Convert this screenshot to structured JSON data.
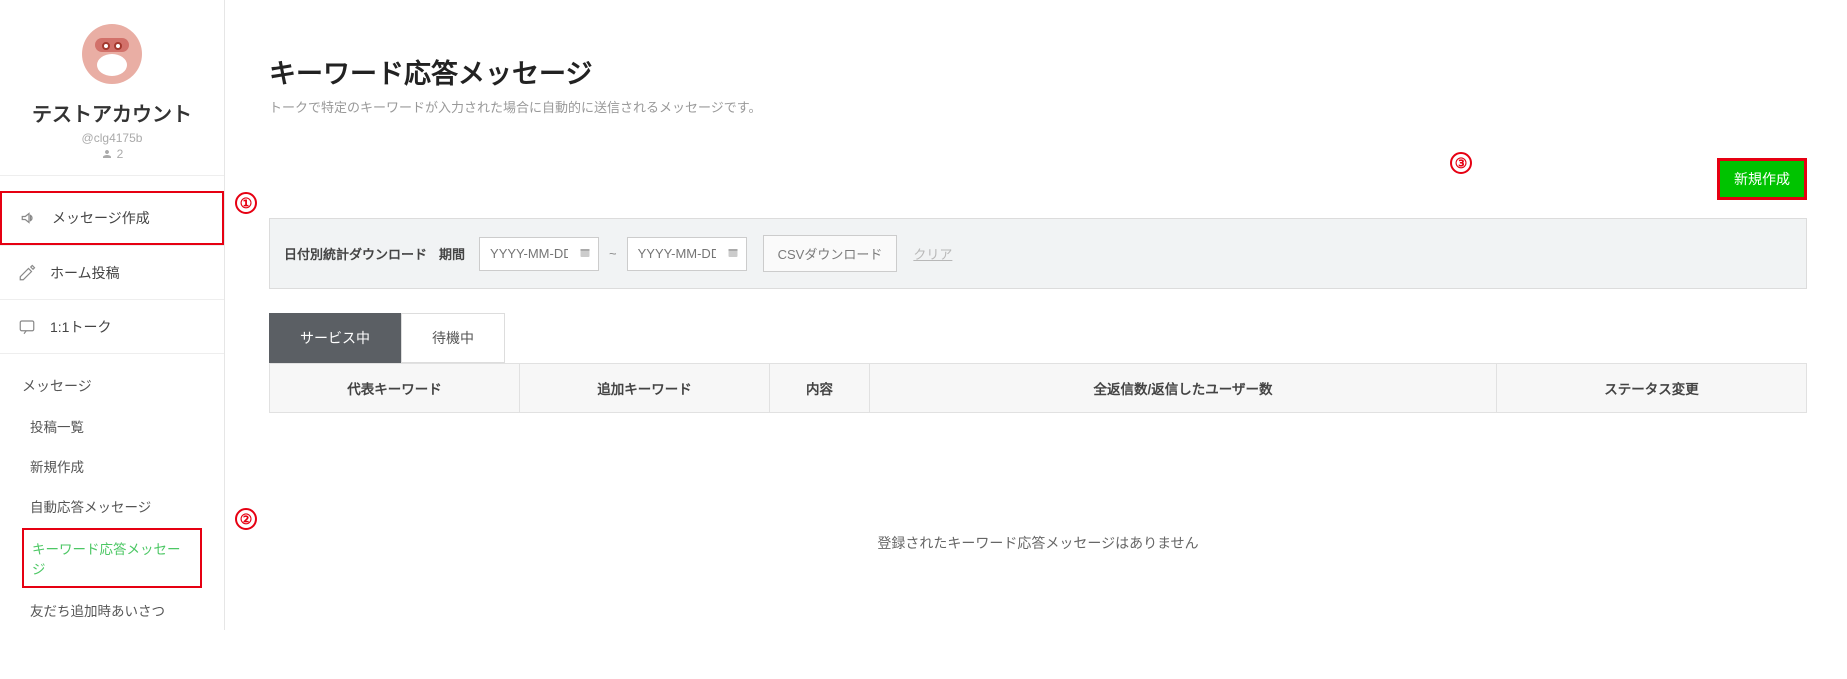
{
  "account": {
    "name": "テストアカウント",
    "id": "@clg4175b",
    "friend_count": "2"
  },
  "nav": {
    "compose": "メッセージ作成",
    "home_post": "ホーム投稿",
    "one_to_one": "1:1トーク"
  },
  "submenu": {
    "header": "メッセージ",
    "items": {
      "list": "投稿一覧",
      "new": "新規作成",
      "auto_reply": "自動応答メッセージ",
      "keyword_reply": "キーワード応答メッセージ",
      "greeting": "友だち追加時あいさつ"
    }
  },
  "page": {
    "title": "キーワード応答メッセージ",
    "desc": "トークで特定のキーワードが入力された場合に自動的に送信されるメッセージです。"
  },
  "actions": {
    "new": "新規作成"
  },
  "filter": {
    "label1": "日付別統計ダウンロード",
    "label2": "期間",
    "placeholder": "YYYY-MM-DD",
    "tilde": "~",
    "csv": "CSVダウンロード",
    "clear": "クリア"
  },
  "tabs": {
    "active": "サービス中",
    "waiting": "待機中"
  },
  "table": {
    "h1": "代表キーワード",
    "h2": "追加キーワード",
    "h3": "内容",
    "h4": "全返信数/返信したユーザー数",
    "h5": "ステータス変更"
  },
  "empty_msg": "登録されたキーワード応答メッセージはありません",
  "annotations": {
    "n1": "①",
    "n2": "②",
    "n3": "③"
  }
}
